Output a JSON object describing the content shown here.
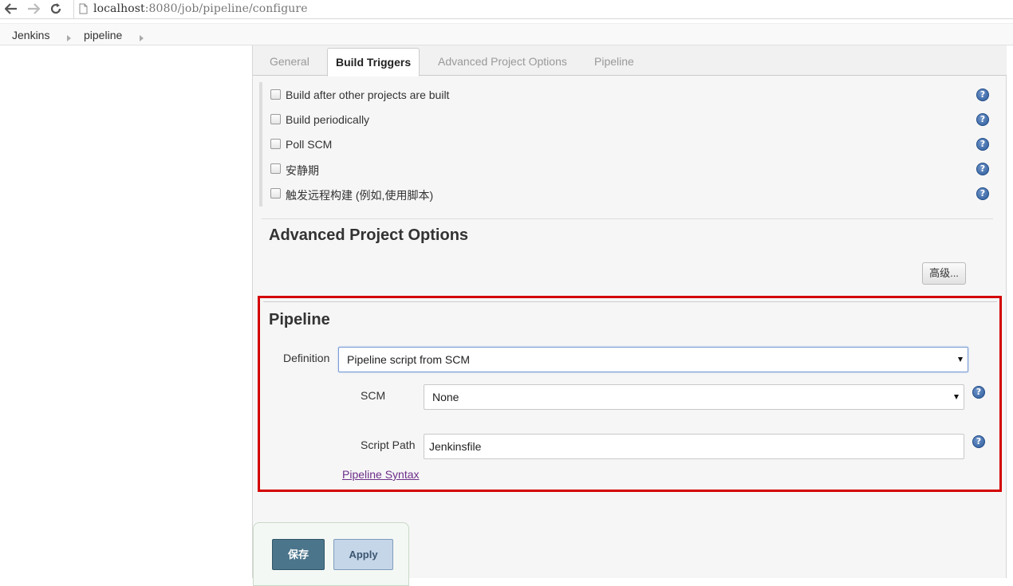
{
  "browser": {
    "url_host": "localhost",
    "url_rest": ":8080/job/pipeline/configure"
  },
  "breadcrumb": {
    "items": [
      {
        "label": "Jenkins"
      },
      {
        "label": "pipeline"
      }
    ]
  },
  "tabs": [
    {
      "label": "General",
      "active": false
    },
    {
      "label": "Build Triggers",
      "active": true
    },
    {
      "label": "Advanced Project Options",
      "active": false
    },
    {
      "label": "Pipeline",
      "active": false
    }
  ],
  "build_triggers": {
    "options": [
      {
        "label": "Build after other projects are built",
        "checked": false
      },
      {
        "label": "Build periodically",
        "checked": false
      },
      {
        "label": "Poll SCM",
        "checked": false
      },
      {
        "label": "安静期",
        "checked": false
      },
      {
        "label": "触发远程构建 (例如,使用脚本)",
        "checked": false
      }
    ]
  },
  "advanced_options": {
    "title": "Advanced Project Options",
    "advanced_button": "高级..."
  },
  "pipeline": {
    "title": "Pipeline",
    "definition_label": "Definition",
    "definition_value": "Pipeline script from SCM",
    "scm_label": "SCM",
    "scm_value": "None",
    "script_path_label": "Script Path",
    "script_path_value": "Jenkinsfile",
    "syntax_link": "Pipeline Syntax"
  },
  "actions": {
    "save_label": "保存",
    "apply_label": "Apply"
  },
  "icons": {
    "help": "?"
  },
  "colors": {
    "highlight": "#d40000",
    "save_bg": "#4b758b",
    "apply_bg": "#c5d6e8",
    "link": "#6d2f8a"
  }
}
